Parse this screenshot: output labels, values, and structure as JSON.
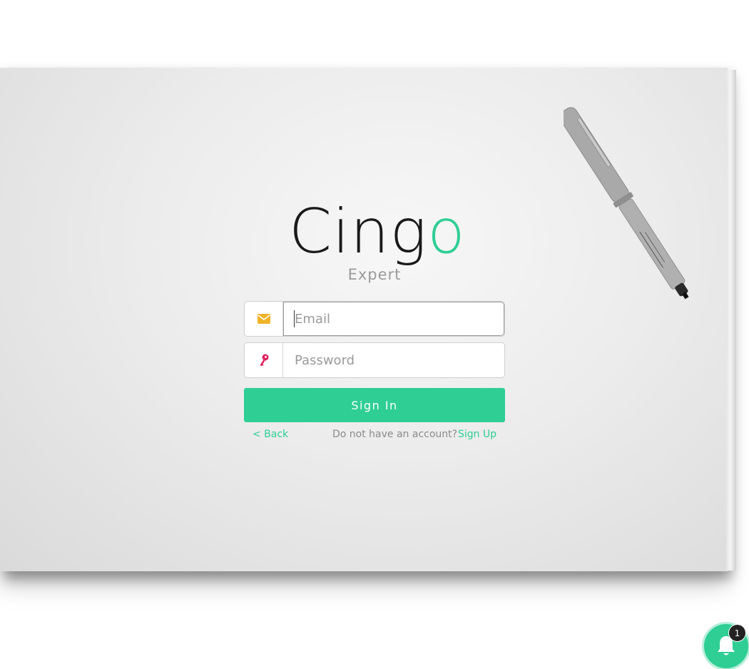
{
  "brand": {
    "logo_text_dark": "Cing",
    "logo_text_accent": "o",
    "subtitle": "Expert",
    "accent_color": "#2ece95",
    "dark_color": "#1a1a1a"
  },
  "form": {
    "email": {
      "placeholder": "Email",
      "value": "",
      "icon": "envelope-icon",
      "icon_color": "#f0b429"
    },
    "password": {
      "placeholder": "Password",
      "value": "",
      "icon": "key-icon",
      "icon_color": "#e0245e"
    },
    "submit_label": "Sign In"
  },
  "footer_links": {
    "back_label": "< Back",
    "no_account_text": "Do not have an account?",
    "signup_label": "Sign Up"
  },
  "notification": {
    "icon": "bell-icon",
    "count": "1"
  }
}
